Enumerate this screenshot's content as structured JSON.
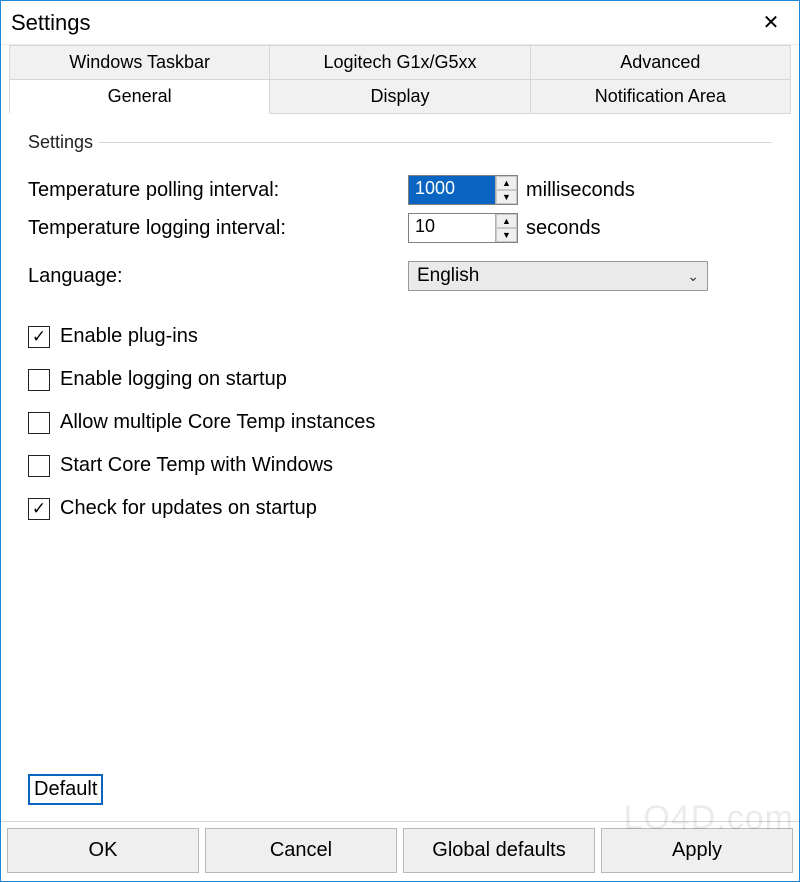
{
  "window": {
    "title": "Settings"
  },
  "tabs": {
    "row1": [
      {
        "label": "Windows Taskbar"
      },
      {
        "label": "Logitech G1x/G5xx"
      },
      {
        "label": "Advanced"
      }
    ],
    "row2": [
      {
        "label": "General",
        "active": true
      },
      {
        "label": "Display"
      },
      {
        "label": "Notification Area"
      }
    ]
  },
  "group": {
    "title": "Settings"
  },
  "fields": {
    "polling": {
      "label": "Temperature polling interval:",
      "value": "1000",
      "unit": "milliseconds"
    },
    "logging": {
      "label": "Temperature logging interval:",
      "value": "10",
      "unit": "seconds"
    },
    "language": {
      "label": "Language:",
      "value": "English"
    }
  },
  "checkboxes": {
    "plugins": {
      "label": "Enable plug-ins",
      "checked": true
    },
    "logstart": {
      "label": "Enable logging on startup",
      "checked": false
    },
    "multi": {
      "label": "Allow multiple Core Temp instances",
      "checked": false
    },
    "startwin": {
      "label": "Start Core Temp with Windows",
      "checked": false
    },
    "updates": {
      "label": "Check for updates on startup",
      "checked": true
    }
  },
  "buttons": {
    "default": "Default",
    "ok": "OK",
    "cancel": "Cancel",
    "globals": "Global defaults",
    "apply": "Apply"
  },
  "watermark": "LO4D.com"
}
